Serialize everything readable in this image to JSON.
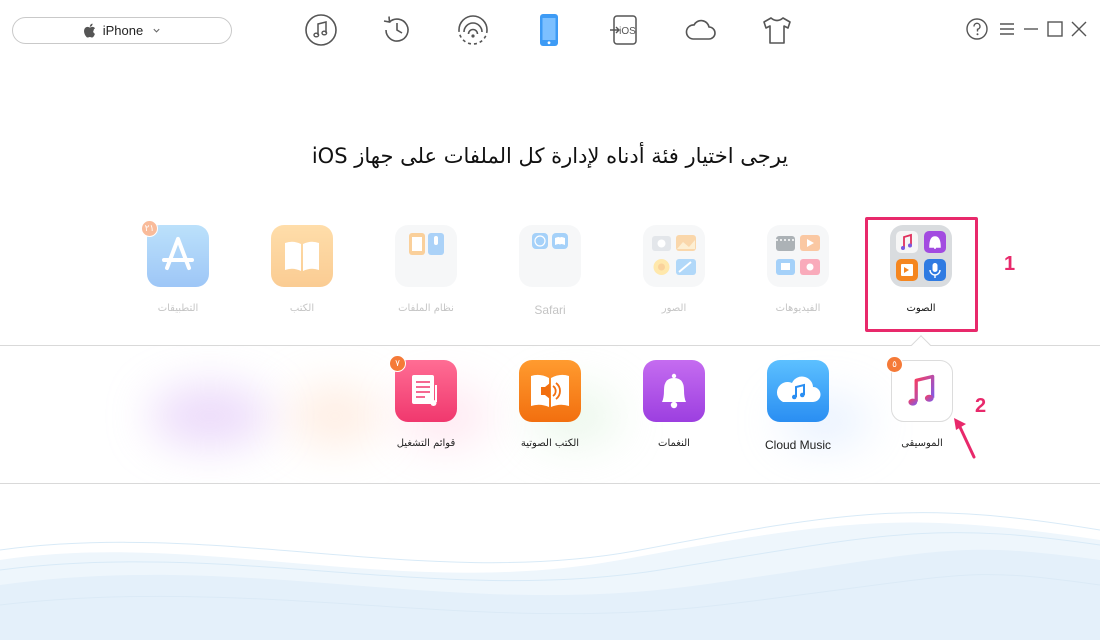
{
  "device": {
    "name": "iPhone",
    "icon": "apple-logo-icon"
  },
  "toolbar": [
    {
      "name": "music-manager-icon"
    },
    {
      "name": "backup-history-icon"
    },
    {
      "name": "wifi-sync-icon"
    },
    {
      "name": "device-manager-icon",
      "active": true
    },
    {
      "name": "ios-mover-icon",
      "text": "iOS"
    },
    {
      "name": "icloud-manager-icon"
    },
    {
      "name": "toolkit-shirt-icon"
    }
  ],
  "window_controls": [
    "help-icon",
    "menu-icon",
    "minimize-icon",
    "maximize-icon",
    "close-icon"
  ],
  "title": "يرجى اختيار فئة أدناه لإدارة كل الملفات على جهاز iOS",
  "categories": [
    {
      "id": "apps",
      "label": "التطبيقات",
      "badge": "٢١"
    },
    {
      "id": "books",
      "label": "الكتب"
    },
    {
      "id": "files",
      "label": "نظام الملفات"
    },
    {
      "id": "safari",
      "label": "Safari"
    },
    {
      "id": "photos",
      "label": "الصور"
    },
    {
      "id": "videos",
      "label": "الفيديوهات"
    },
    {
      "id": "audio",
      "label": "الصوت",
      "active": true
    }
  ],
  "audio_items": [
    {
      "id": "playlists",
      "label": "قوائم التشغيل",
      "badge": "٧"
    },
    {
      "id": "audiobooks",
      "label": "الكتب الصوتية"
    },
    {
      "id": "ringtones",
      "label": "النغمات"
    },
    {
      "id": "cloud-music",
      "label": "Cloud Music"
    },
    {
      "id": "music",
      "label": "الموسيقى",
      "badge": "٥"
    }
  ],
  "callouts": [
    "1",
    "2"
  ],
  "colors": {
    "accent_pink": "#e8296b",
    "badge_orange": "#f57a38",
    "active_blue": "#3d9bf5",
    "icon_gray": "#555555"
  }
}
